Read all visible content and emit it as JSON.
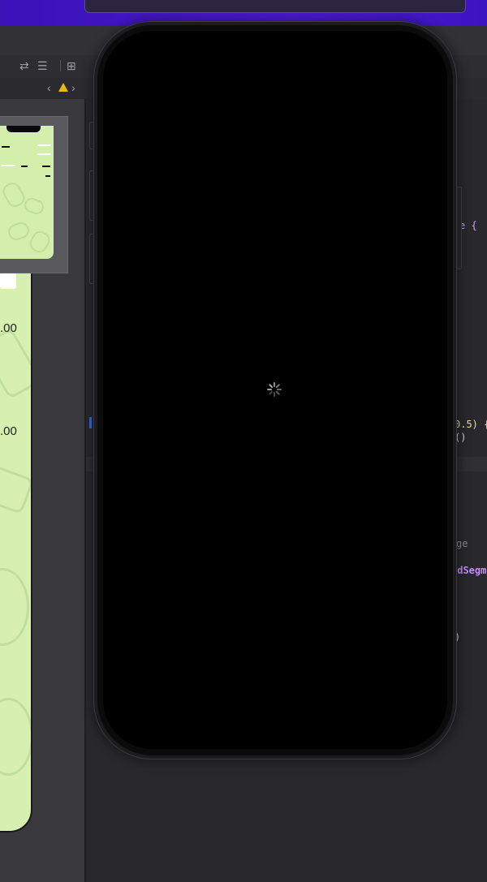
{
  "desktop": {
    "accent": "#3d14c2"
  },
  "toolbar": {
    "icons": [
      "swap-arrows-icon",
      "align-lines-icon",
      "add-editor-icon"
    ]
  },
  "jumpbar": {
    "nav_back": "‹",
    "nav_forward": "›",
    "warning_icon": "warning-icon"
  },
  "preview": {
    "amount_top": ".00",
    "amount_bottom": ".00",
    "background": "#d7f0b2"
  },
  "code": {
    "line_1": "e {",
    "line_2a": "0.5) {",
    "line_2b": "()",
    "line_3": "ge",
    "line_4": "edSegm",
    "line_5": ")"
  },
  "simulator": {
    "screen_color": "#000000",
    "state": "loading"
  }
}
